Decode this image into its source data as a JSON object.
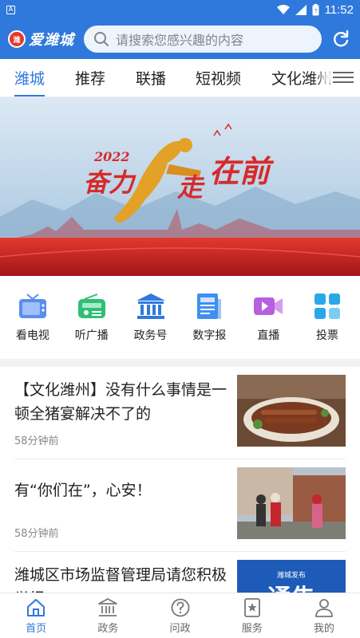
{
  "status_bar": {
    "time": "11:52",
    "notification_icon": "A"
  },
  "header": {
    "logo_text": "爱潍城",
    "logo_badge": "潍",
    "search_placeholder": "请搜索您感兴趣的内容"
  },
  "tabs": [
    {
      "label": "潍城",
      "active": true
    },
    {
      "label": "推荐"
    },
    {
      "label": "联播"
    },
    {
      "label": "短视频"
    },
    {
      "label": "文化潍州"
    }
  ],
  "banner": {
    "year": "2022",
    "slogan_1": "奋力",
    "slogan_2": "走",
    "slogan_3": "在前"
  },
  "quick_links": [
    {
      "label": "看电视",
      "icon": "tv-icon",
      "color": "#5b8def"
    },
    {
      "label": "听广播",
      "icon": "radio-icon",
      "color": "#2fbf74"
    },
    {
      "label": "政务号",
      "icon": "government-building-icon",
      "color": "#2f79dc"
    },
    {
      "label": "数字报",
      "icon": "newspaper-icon",
      "color": "#3f8ff0"
    },
    {
      "label": "直播",
      "icon": "video-camera-icon",
      "color": "#b85ee0"
    },
    {
      "label": "投票",
      "icon": "grid-icon",
      "color": "#29a8e8"
    }
  ],
  "news": [
    {
      "title": "【文化潍州】没有什么事情是一顿全猪宴解决不了的",
      "time": "58分钟前"
    },
    {
      "title": "有“你们在”，心安！",
      "time": "58分钟前"
    },
    {
      "title": "潍城区市场监督管理局请您积极举报",
      "time": "",
      "thumb_text": "通告",
      "thumb_small": "潍城发布"
    }
  ],
  "bottom_nav": [
    {
      "label": "首页",
      "icon": "home-icon",
      "active": true
    },
    {
      "label": "政务",
      "icon": "government-icon"
    },
    {
      "label": "问政",
      "icon": "question-icon"
    },
    {
      "label": "服务",
      "icon": "service-star-icon"
    },
    {
      "label": "我的",
      "icon": "profile-icon"
    }
  ],
  "colors": {
    "brand_blue": "#2f79dc",
    "banner_red": "#d52b2b"
  }
}
